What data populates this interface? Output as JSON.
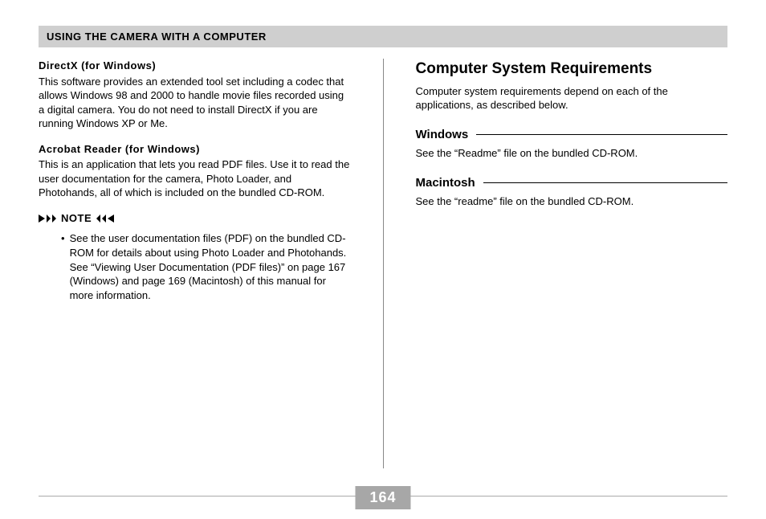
{
  "header": "USING THE CAMERA WITH A COMPUTER",
  "left": {
    "sec1": {
      "title": "DirectX (for Windows)",
      "text": "This software provides an extended tool set including a codec that allows Windows 98 and 2000 to handle movie files recorded using a digital camera. You do not need to install DirectX if you are running Windows XP or Me."
    },
    "sec2": {
      "title": "Acrobat Reader (for Windows)",
      "text": "This is an application that lets you read PDF files. Use it to read the user documentation for the camera, Photo Loader, and Photohands, all of which is included on the bundled CD-ROM."
    },
    "note": {
      "label": "NOTE",
      "item": "See the user documentation files (PDF) on the bundled CD-ROM for details about using Photo Loader and Photohands. See “Viewing User Documentation (PDF files)” on page 167 (Windows) and page 169 (Macintosh) of this manual for more information."
    }
  },
  "right": {
    "h1": "Computer System Requirements",
    "intro": "Computer system requirements depend on each of the applications, as described below.",
    "win": {
      "title": "Windows",
      "text": "See the “Readme” file on the bundled CD-ROM."
    },
    "mac": {
      "title": "Macintosh",
      "text": "See the “readme” file on the bundled CD-ROM."
    }
  },
  "pageNumber": "164"
}
